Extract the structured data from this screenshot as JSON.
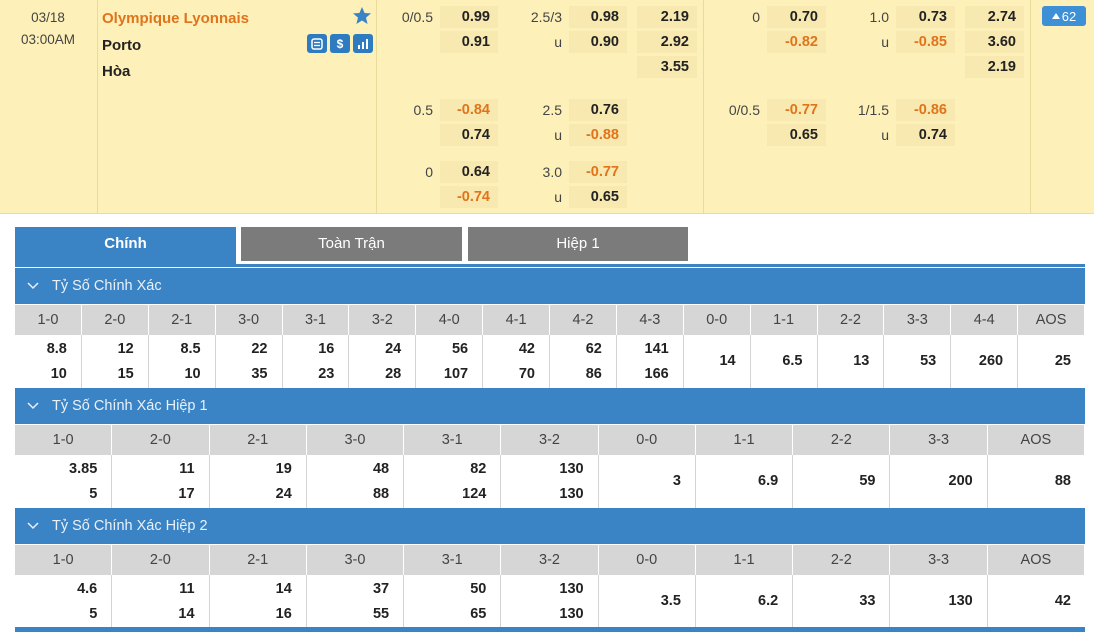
{
  "match": {
    "date": "03/18",
    "time": "03:00AM",
    "home": "Olympique Lyonnais",
    "away": "Porto",
    "draw": "Hòa",
    "more_count": "62",
    "icons": [
      "favorite-star-icon",
      "stats-book-icon",
      "dollar-icon",
      "bar-chart-icon"
    ],
    "ft_handicap": [
      {
        "line": "0/0.5",
        "home": "0.99",
        "away": "0.91"
      },
      {
        "line": "0.5",
        "home": "-0.84",
        "away": "0.74"
      },
      {
        "line": "0",
        "home": "0.64",
        "away": "-0.74"
      }
    ],
    "ft_total": [
      {
        "line": "2.5/3",
        "over": "0.98",
        "u": "u",
        "under": "0.90"
      },
      {
        "line": "2.5",
        "over": "0.76",
        "u": "u",
        "under": "-0.88"
      },
      {
        "line": "3.0",
        "over": "-0.77",
        "u": "u",
        "under": "0.65"
      }
    ],
    "ft_1x2": [
      "2.19",
      "2.92",
      "3.55"
    ],
    "h1_handicap": [
      {
        "line": "0",
        "home": "0.70",
        "away": "-0.82"
      },
      {
        "line": "0/0.5",
        "home": "-0.77",
        "away": "0.65"
      }
    ],
    "h1_total": [
      {
        "line": "1.0",
        "over": "0.73",
        "u": "u",
        "under": "-0.85"
      },
      {
        "line": "1/1.5",
        "over": "-0.86",
        "u": "u",
        "under": "0.74"
      }
    ],
    "h1_1x2": [
      "2.74",
      "3.60",
      "2.19"
    ]
  },
  "tabs": [
    "Chính",
    "Toàn Trận",
    "Hiệp 1"
  ],
  "sections": [
    {
      "title": "Tỷ Số Chính Xác",
      "headers": [
        "1-0",
        "2-0",
        "2-1",
        "3-0",
        "3-1",
        "3-2",
        "4-0",
        "4-1",
        "4-2",
        "4-3",
        "0-0",
        "1-1",
        "2-2",
        "3-3",
        "4-4",
        "AOS"
      ],
      "values": [
        [
          "8.8",
          "10"
        ],
        [
          "12",
          "15"
        ],
        [
          "8.5",
          "10"
        ],
        [
          "22",
          "35"
        ],
        [
          "16",
          "23"
        ],
        [
          "24",
          "28"
        ],
        [
          "56",
          "107"
        ],
        [
          "42",
          "70"
        ],
        [
          "62",
          "86"
        ],
        [
          "141",
          "166"
        ],
        [
          "14"
        ],
        [
          "6.5"
        ],
        [
          "13"
        ],
        [
          "53"
        ],
        [
          "260"
        ],
        [
          "25"
        ]
      ]
    },
    {
      "title": "Tỷ Số Chính Xác Hiệp 1",
      "headers": [
        "1-0",
        "2-0",
        "2-1",
        "3-0",
        "3-1",
        "3-2",
        "0-0",
        "1-1",
        "2-2",
        "3-3",
        "AOS"
      ],
      "values": [
        [
          "3.85",
          "5"
        ],
        [
          "11",
          "17"
        ],
        [
          "19",
          "24"
        ],
        [
          "48",
          "88"
        ],
        [
          "82",
          "124"
        ],
        [
          "130",
          "130"
        ],
        [
          "3"
        ],
        [
          "6.9"
        ],
        [
          "59"
        ],
        [
          "200"
        ],
        [
          "88"
        ]
      ]
    },
    {
      "title": "Tỷ Số Chính Xác Hiệp 2",
      "headers": [
        "1-0",
        "2-0",
        "2-1",
        "3-0",
        "3-1",
        "3-2",
        "0-0",
        "1-1",
        "2-2",
        "3-3",
        "AOS"
      ],
      "values": [
        [
          "4.6",
          "5"
        ],
        [
          "11",
          "14"
        ],
        [
          "14",
          "16"
        ],
        [
          "37",
          "55"
        ],
        [
          "50",
          "65"
        ],
        [
          "130",
          "130"
        ],
        [
          "3.5"
        ],
        [
          "6.2"
        ],
        [
          "33"
        ],
        [
          "130"
        ],
        [
          "42"
        ]
      ]
    }
  ],
  "colors": {
    "accent": "#3a83c4",
    "negative": "#e0741c",
    "header_bg": "#fdf0b8"
  }
}
